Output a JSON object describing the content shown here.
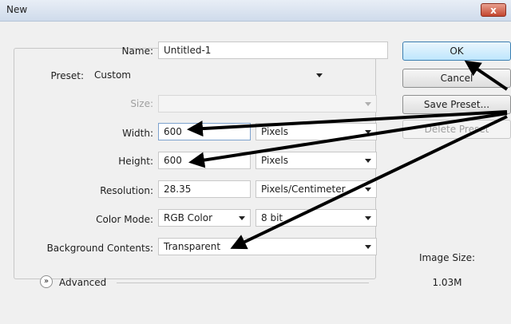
{
  "window": {
    "title": "New",
    "close_label": "x"
  },
  "form": {
    "name_label": "Name:",
    "name_value": "Untitled-1",
    "preset_label": "Preset:",
    "preset_value": "Custom",
    "size_label": "Size:",
    "size_value": "",
    "width_label": "Width:",
    "width_value": "600",
    "width_unit": "Pixels",
    "height_label": "Height:",
    "height_value": "600",
    "height_unit": "Pixels",
    "resolution_label": "Resolution:",
    "resolution_value": "28.35",
    "resolution_unit": "Pixels/Centimeter",
    "color_mode_label": "Color Mode:",
    "color_mode_value": "RGB Color",
    "bit_depth_value": "8 bit",
    "background_label": "Background Contents:",
    "background_value": "Transparent",
    "advanced_label": "Advanced"
  },
  "buttons": {
    "ok": "OK",
    "cancel": "Cancel",
    "save_preset": "Save Preset...",
    "delete_preset": "Delete Preset"
  },
  "image_size": {
    "label": "Image Size:",
    "value": "1.03M"
  }
}
